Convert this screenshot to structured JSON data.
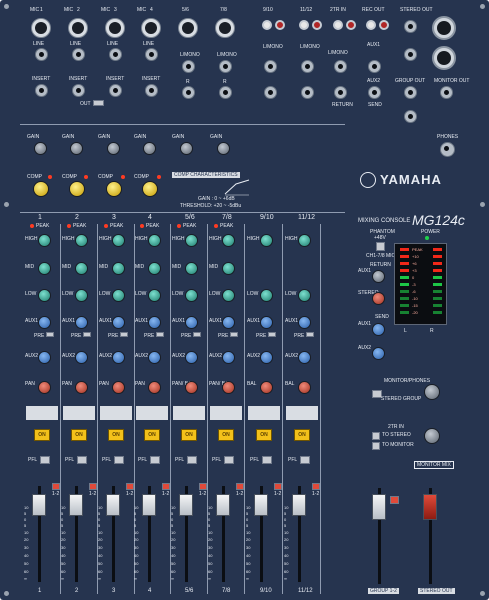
{
  "brand": "YAMAHA",
  "model_prefix": "MIXING CONSOLE",
  "model_name": "MG124c",
  "top_inputs": {
    "mic_labels": [
      "MIC",
      "MIC",
      "MIC",
      "MIC"
    ],
    "channel_numbers": [
      "1",
      "2",
      "3",
      "4",
      "5/6",
      "7/8",
      "9/10",
      "11/12"
    ],
    "insert_label": "INSERT",
    "line_label": "LINE",
    "l_mono": "L/MONO",
    "r_label": "R",
    "l_label": "L",
    "out_label": "OUT",
    "in_label": "IN",
    "two_tr_in": "2TR IN",
    "rec_out": "REC OUT",
    "aux1": "AUX1",
    "aux2": "AUX2",
    "return_label": "RETURN",
    "send_label": "SEND",
    "stereo_out": "STEREO OUT",
    "group_out": "GROUP OUT",
    "monitor_out": "MONITOR OUT",
    "phones": "PHONES"
  },
  "comp_section": {
    "gain": "GAIN",
    "comp": "COMP",
    "comp_characteristics": "COMP CHARACTERISTICS",
    "gain_value": "GAIN : 0 ~ +6dB",
    "threshold_value": "THRESHOLD: +20 ~ -5dBu"
  },
  "strip_numbers": [
    "1",
    "2",
    "3",
    "4",
    "5/6",
    "7/8",
    "9/10",
    "11/12"
  ],
  "strip_labels": {
    "peak": "PEAK",
    "high": "HIGH",
    "mid": "MID",
    "low": "LOW",
    "aux1": "AUX1",
    "aux2": "AUX2",
    "pan": "PAN",
    "pan_bal": "PAN/ BAL",
    "bal": "BAL",
    "pre": "PRE",
    "on": "ON",
    "pfl": "PFL",
    "one_two": "1-2"
  },
  "master": {
    "phantom": "PHANTOM",
    "phantom_sub": "+48V",
    "phantom_ch": "CH1-7/8 MIC",
    "power": "POWER",
    "return": "RETURN",
    "aux1": "AUX1",
    "stereo": "STEREO",
    "send": "SEND",
    "aux1b": "AUX1",
    "aux2": "AUX2",
    "monitor_phones": "MONITOR/PHONES",
    "stereo_group": "STEREO GROUP",
    "two_tr_in": "2TR IN",
    "to_stereo": "TO STEREO",
    "to_monitor": "TO MONITOR",
    "monitor_mix": "MONITOR MIX",
    "group_12": "GROUP 1-2",
    "stereo_out": "STEREO OUT",
    "meter_l": "L",
    "meter_r": "R",
    "meter_marks": [
      "PEAK",
      "+10",
      "+6",
      "+3",
      "0",
      "-3",
      "-6",
      "-10",
      "-15",
      "-20"
    ]
  },
  "fader_scale": [
    "10",
    "5",
    "0",
    "5",
    "10",
    "20",
    "30",
    "40",
    "50",
    "60",
    "∞"
  ],
  "colors": {
    "panel": "#26344f",
    "on_button": "#f3c11a",
    "peak_led": "#ff3b22",
    "meter_green": "#1fd14a",
    "meter_red": "#ff2a1a"
  }
}
